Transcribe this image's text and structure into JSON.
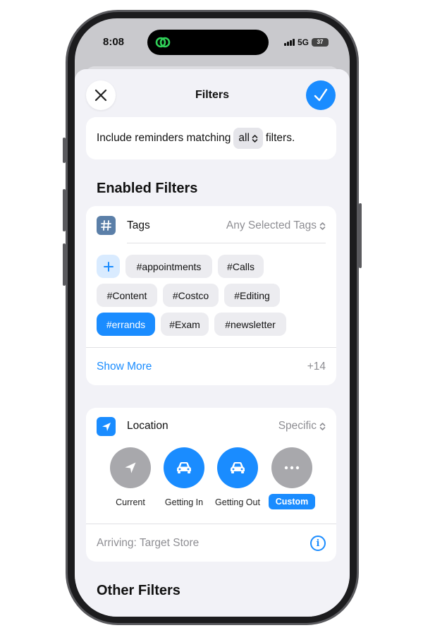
{
  "status_bar": {
    "time": "8:08",
    "network": "5G",
    "battery": "37"
  },
  "sheet": {
    "title": "Filters",
    "close_icon": "close-icon",
    "done_icon": "checkmark-icon"
  },
  "match": {
    "prefix": "Include reminders matching",
    "value": "all",
    "suffix": "filters."
  },
  "enabled_filters": {
    "heading": "Enabled Filters",
    "tags": {
      "label": "Tags",
      "value": "Any Selected Tags",
      "chips": [
        {
          "label": "#appointments",
          "selected": false
        },
        {
          "label": "#Calls",
          "selected": false
        },
        {
          "label": "#Content",
          "selected": false
        },
        {
          "label": "#Costco",
          "selected": false
        },
        {
          "label": "#Editing",
          "selected": false
        },
        {
          "label": "#errands",
          "selected": true
        },
        {
          "label": "#Exam",
          "selected": false
        },
        {
          "label": "#newsletter",
          "selected": false
        }
      ],
      "show_more": "Show More",
      "more_count": "+14"
    },
    "location": {
      "label": "Location",
      "value": "Specific",
      "options": [
        {
          "label": "Current",
          "icon": "location-arrow-icon"
        },
        {
          "label": "Getting In",
          "icon": "car-icon"
        },
        {
          "label": "Getting Out",
          "icon": "car-icon"
        },
        {
          "label": "Custom",
          "icon": "more-icon"
        }
      ],
      "arriving": "Arriving: Target Store"
    }
  },
  "other_filters": {
    "heading": "Other Filters"
  },
  "colors": {
    "accent": "#1a8cff",
    "sheet_background": "#f2f2f7",
    "card_background": "#ffffff",
    "secondary_text": "#8e8e93",
    "tag_icon_bg": "#5b7fa8"
  }
}
